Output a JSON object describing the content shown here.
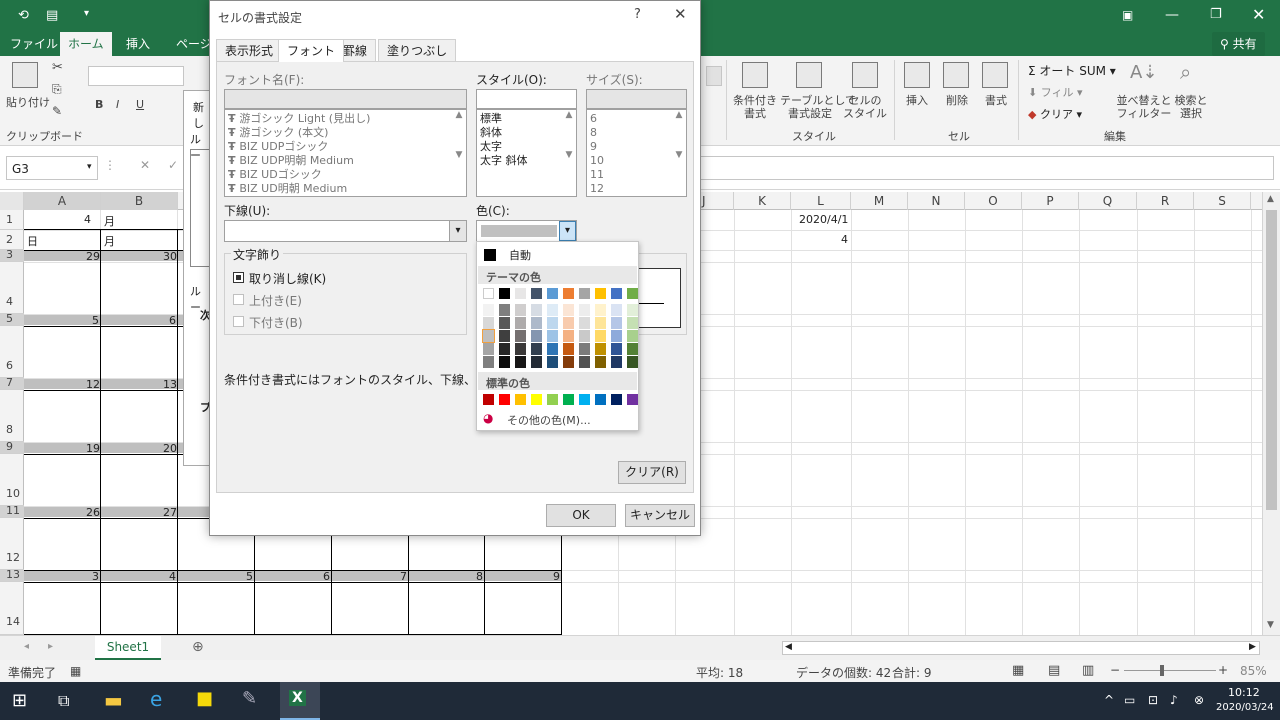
{
  "title_bar": {
    "window_controls": [
      "minimize-icon",
      "restore-icon",
      "close-icon"
    ]
  },
  "ribbon_tabs": [
    "ファイル",
    "ホーム",
    "挿入",
    "ページ"
  ],
  "share_label": "共有",
  "ribbon": {
    "paste_label": "貼り付け",
    "clipboard_group": "クリップボード",
    "autosum_label": "オート SUM",
    "fill_label": "フィル",
    "clear_label": "クリア",
    "sort_filter_label": "並べ替えと\nフィルター",
    "find_select_label": "検索と\n選択",
    "conditional_label": "条件付き\n書式",
    "table_label": "テーブルとして\n書式設定",
    "cell_style_label": "セルの\nスタイル",
    "insert_label": "挿入",
    "delete_label": "削除",
    "format_label": "書式",
    "style_group": "スタイル",
    "cells_group": "セル",
    "edit_group": "編集"
  },
  "formula_bar": {
    "name_box": "G3"
  },
  "columns": [
    "A",
    "B",
    "J",
    "K",
    "L",
    "M",
    "N",
    "O",
    "P",
    "Q",
    "R",
    "S"
  ],
  "rows": [
    "1",
    "2",
    "3",
    "4",
    "5",
    "6",
    "7",
    "8",
    "9",
    "10",
    "11",
    "12",
    "13",
    "14"
  ],
  "cells": {
    "a1": "4",
    "b1": "月",
    "a2": "日",
    "b2": "月",
    "l1": "2020/4/1",
    "l2": "4",
    "r3a": "29",
    "r3b": "30",
    "r5a": "5",
    "r5b": "6",
    "r7a": "12",
    "r7b": "13",
    "r9a": "19",
    "r9b": "20",
    "r11a": "26",
    "r11b": "27",
    "r13": [
      "3",
      "4",
      "5",
      "6",
      "7",
      "8",
      "9"
    ]
  },
  "behind_dialog": {
    "label1": "新し",
    "label2": "ルー",
    "label3": "ルー",
    "label4": "次",
    "label5": "プ"
  },
  "sheet_tab": "Sheet1",
  "status": {
    "ready": "準備完了",
    "average": "平均: 18",
    "count": "データの個数: 42",
    "sum": "合計: 9",
    "zoom": "85%"
  },
  "taskbar": {
    "time": "10:12",
    "date": "2020/03/24"
  },
  "dialog": {
    "title": "セルの書式設定",
    "help": "?",
    "tabs": [
      "表示形式",
      "フォント",
      "罫線",
      "塗りつぶし"
    ],
    "font_name_label": "フォント名(F):",
    "fonts": [
      "游ゴシック Light (見出し)",
      "游ゴシック (本文)",
      "BIZ UDPゴシック",
      "BIZ UDP明朝 Medium",
      "BIZ UDゴシック",
      "BIZ UD明朝 Medium"
    ],
    "style_label": "スタイル(O):",
    "styles": [
      "標準",
      "斜体",
      "太字",
      "太字 斜体"
    ],
    "size_label": "サイズ(S):",
    "sizes": [
      "6",
      "8",
      "9",
      "10",
      "11",
      "12"
    ],
    "underline_label": "下線(U):",
    "color_label": "色(C):",
    "effects_label": "文字飾り",
    "strike_label": "取り消し線(K)",
    "super_label": "上付き(E)",
    "sub_label": "下付き(B)",
    "note": "条件付き書式にはフォントのスタイル、下線、色、および取",
    "clear_button": "クリア(R)",
    "ok_button": "OK",
    "cancel_button": "キャンセル"
  },
  "color_popup": {
    "auto_label": "自動",
    "theme_label": "テーマの色",
    "theme_colors": [
      "#ffffff",
      "#000000",
      "#e7e6e6",
      "#44546a",
      "#5b9bd5",
      "#ed7d31",
      "#a5a5a5",
      "#ffc000",
      "#4472c4",
      "#70ad47"
    ],
    "shades": [
      [
        "#f2f2f2",
        "#7f7f7f",
        "#d0cece",
        "#d6dce4",
        "#deebf6",
        "#fbe5d5",
        "#ededed",
        "#fff2cc",
        "#dae3f3",
        "#e2efd9"
      ],
      [
        "#d8d8d8",
        "#595959",
        "#aeabab",
        "#adb9ca",
        "#bdd7ee",
        "#f8cbad",
        "#dbdbdb",
        "#fee599",
        "#b4c6e7",
        "#c5e0b3"
      ],
      [
        "#bfbfbf",
        "#3f3f3f",
        "#757070",
        "#8496b0",
        "#9dc3e6",
        "#f4b183",
        "#c9c9c9",
        "#ffd965",
        "#8eaadb",
        "#a8d08d"
      ],
      [
        "#a5a5a5",
        "#262626",
        "#3a3838",
        "#323f4f",
        "#2e75b5",
        "#c55a11",
        "#7b7b7b",
        "#bf9000",
        "#2f5496",
        "#538135"
      ],
      [
        "#7f7f7f",
        "#0c0c0c",
        "#171616",
        "#222a35",
        "#1e4e79",
        "#843c0b",
        "#525252",
        "#7f6000",
        "#1f3864",
        "#375623"
      ]
    ],
    "standard_label": "標準の色",
    "standard_colors": [
      "#c00000",
      "#ff0000",
      "#ffc000",
      "#ffff00",
      "#92d050",
      "#00b050",
      "#00b0f0",
      "#0070c0",
      "#002060",
      "#7030a0"
    ],
    "more_label": "その他の色(M)..."
  }
}
